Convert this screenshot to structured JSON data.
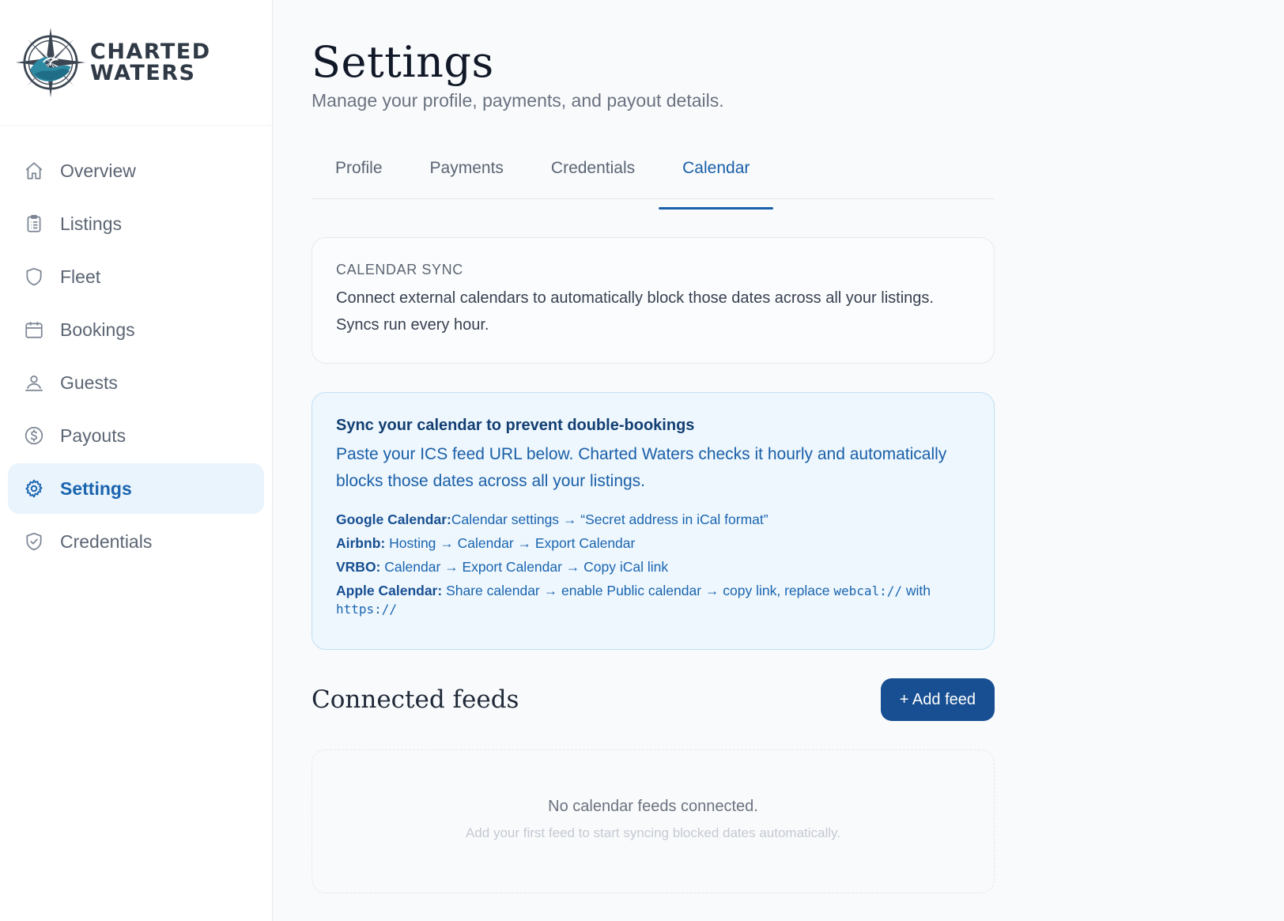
{
  "brand": {
    "line1": "CHARTED",
    "line2": "WATERS"
  },
  "sidebar": {
    "items": [
      {
        "label": "Overview",
        "icon": "home-icon"
      },
      {
        "label": "Listings",
        "icon": "clipboard-icon"
      },
      {
        "label": "Fleet",
        "icon": "shield-icon"
      },
      {
        "label": "Bookings",
        "icon": "calendar-icon"
      },
      {
        "label": "Guests",
        "icon": "users-icon"
      },
      {
        "label": "Payouts",
        "icon": "dollar-icon"
      },
      {
        "label": "Settings",
        "icon": "gear-icon",
        "active": true
      },
      {
        "label": "Credentials",
        "icon": "shield-check-icon"
      }
    ]
  },
  "header": {
    "title": "Settings",
    "subtitle": "Manage your profile, payments, and payout details."
  },
  "tabs": [
    {
      "label": "Profile"
    },
    {
      "label": "Payments"
    },
    {
      "label": "Credentials"
    },
    {
      "label": "Calendar",
      "active": true
    }
  ],
  "calendar_sync": {
    "eyebrow": "CALENDAR SYNC",
    "description": "Connect external calendars to automatically block those dates across all your listings. Syncs run every hour."
  },
  "info": {
    "title": "Sync your calendar to prevent double-bookings",
    "text": "Paste your ICS feed URL below. Charted Waters checks it hourly and automatically blocks those dates across all your listings.",
    "steps": [
      {
        "name": "Google Calendar:",
        "text": "Calendar settings → “Secret address in iCal format”"
      },
      {
        "name": "Airbnb:",
        "text": " Hosting → Calendar → Export Calendar"
      },
      {
        "name": "VRBO:",
        "text": " Calendar → Export Calendar → Copy iCal link"
      },
      {
        "name": "Apple Calendar:",
        "text": " Share calendar → enable Public calendar → copy link, replace ",
        "code1": "webcal://",
        "mid": " with",
        "code2": "https://"
      }
    ]
  },
  "feeds": {
    "title": "Connected feeds",
    "add_label": "+ Add feed",
    "empty_title": "No calendar feeds connected.",
    "empty_sub": "Add your first feed to start syncing blocked dates automatically."
  },
  "colors": {
    "accent": "#1a5fa8",
    "button": "#174f92",
    "active_nav_bg": "#eaf4fc",
    "info_bg": "#eef7fd"
  }
}
